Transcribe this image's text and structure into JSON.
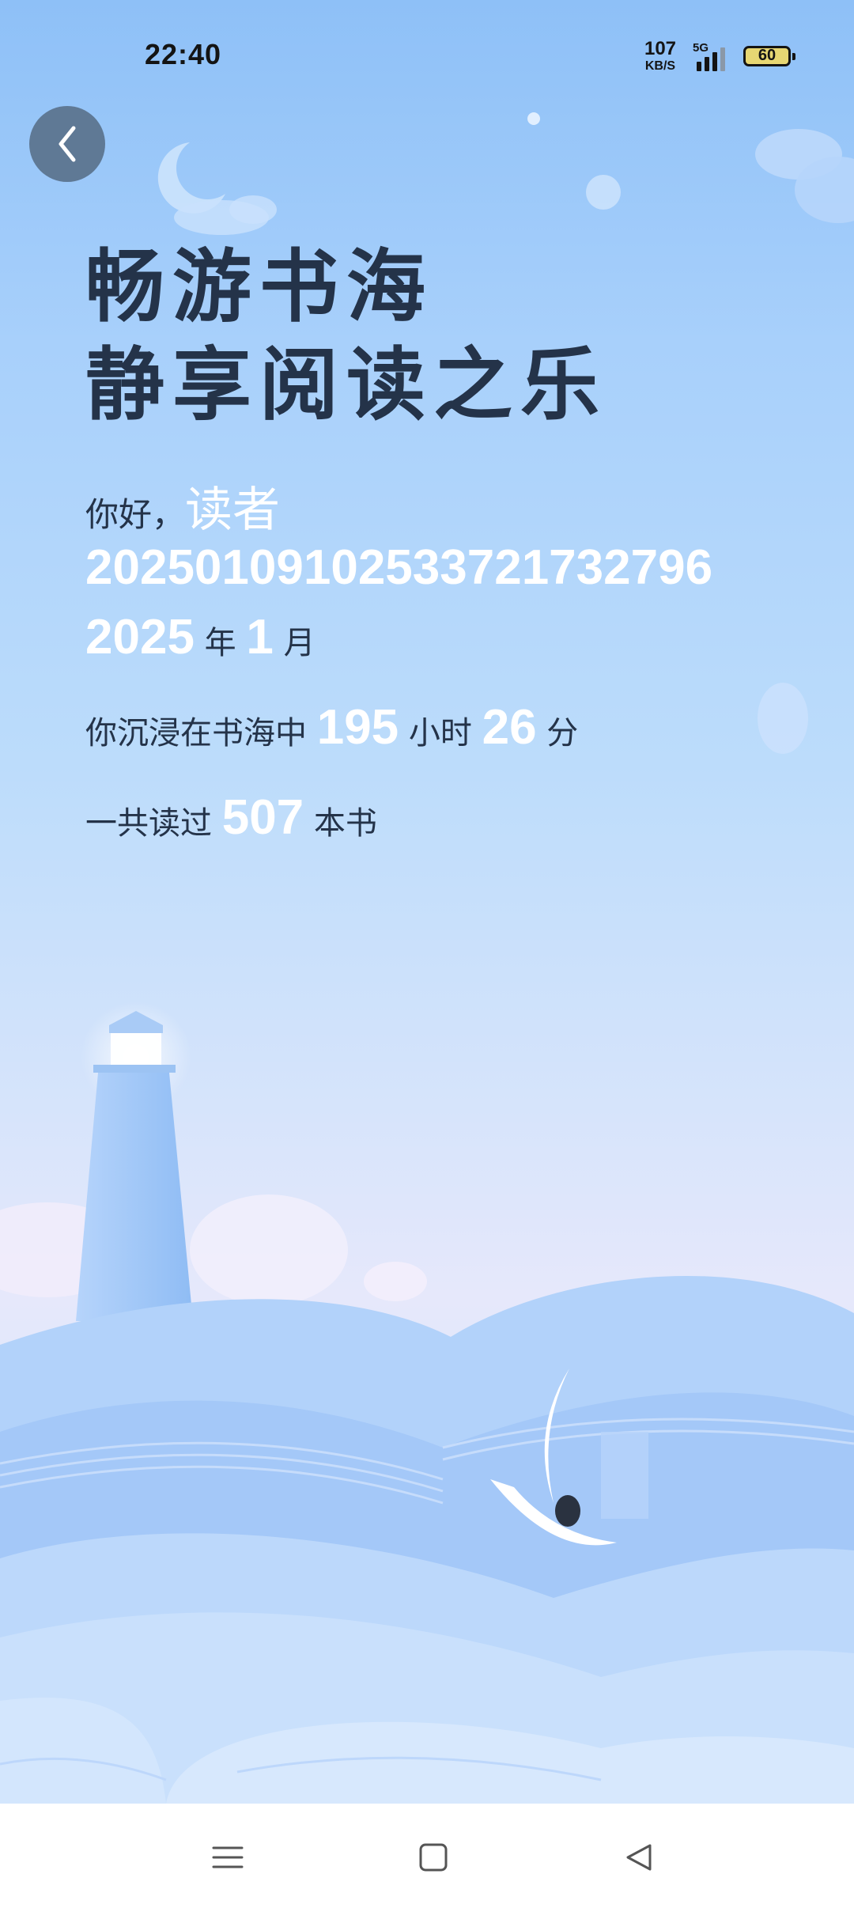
{
  "status_bar": {
    "time": "22:40",
    "net_speed_value": "107",
    "net_speed_unit": "KB/S",
    "network_type": "5G",
    "battery_level": "60"
  },
  "header": {
    "slogan_line1": "畅游书海",
    "slogan_line2": "静享阅读之乐"
  },
  "greeting": {
    "prefix": "你好，",
    "reader_label": "读者",
    "reader_id": "20250109102533721732796"
  },
  "period": {
    "year": "2025",
    "year_unit": "年",
    "month": "1",
    "month_unit": "月"
  },
  "reading_time": {
    "prefix": "你沉浸在书海中",
    "hours": "195",
    "hours_unit": "小时",
    "minutes": "26",
    "minutes_unit": "分"
  },
  "books": {
    "prefix": "一共读过",
    "count": "507",
    "unit": "本书"
  },
  "icons": {
    "back": "chevron-left-icon",
    "nav_menu": "menu-icon",
    "nav_home": "home-square-icon",
    "nav_back": "back-triangle-icon"
  },
  "colors": {
    "title_text": "#243349",
    "highlight_number": "#ffffff",
    "back_button_bg": "#5f7995",
    "battery_fill": "#e7d773"
  }
}
